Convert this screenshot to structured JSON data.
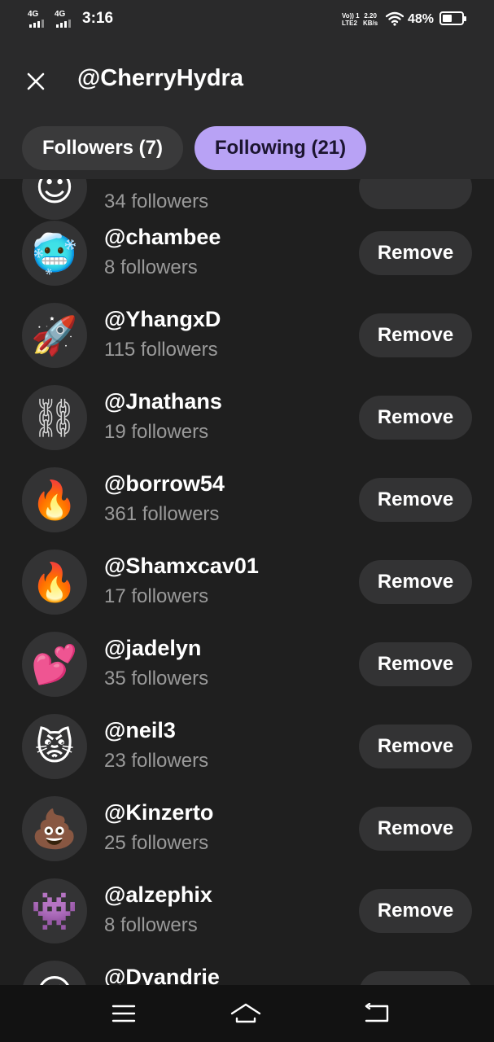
{
  "status_bar": {
    "signal1": "4G",
    "signal2": "4G",
    "time": "3:16",
    "volte_top": "Vo)) 1",
    "volte_bottom": "LTE2",
    "speed_value": "2.20",
    "speed_unit": "KB/s",
    "battery": "48%",
    "battery_level": 0.48
  },
  "header": {
    "title": "@CherryHydra",
    "tabs": [
      {
        "label": "Followers (7)",
        "selected": false
      },
      {
        "label": "Following (21)",
        "selected": true
      }
    ]
  },
  "list": {
    "items": [
      {
        "username": "",
        "followers": "34 followers",
        "avatar": "😇",
        "remove_label": ""
      },
      {
        "username": "@chambee",
        "followers": "8 followers",
        "avatar": "🥶",
        "remove_label": "Remove"
      },
      {
        "username": "@YhangxD",
        "followers": "115 followers",
        "avatar": "🚀",
        "remove_label": "Remove"
      },
      {
        "username": "@Jnathans",
        "followers": "19 followers",
        "avatar": "⛓",
        "remove_label": "Remove"
      },
      {
        "username": "@borrow54",
        "followers": "361 followers",
        "avatar": "🔥",
        "remove_label": "Remove"
      },
      {
        "username": "@Shamxcav01",
        "followers": "17 followers",
        "avatar": "🔥",
        "remove_label": "Remove"
      },
      {
        "username": "@jadelyn",
        "followers": "35 followers",
        "avatar": "💕",
        "remove_label": "Remove"
      },
      {
        "username": "@neil3",
        "followers": "23 followers",
        "avatar": "😾",
        "remove_label": "Remove"
      },
      {
        "username": "@Kinzerto",
        "followers": "25 followers",
        "avatar": "💩",
        "remove_label": "Remove"
      },
      {
        "username": "@alzephix",
        "followers": "8 followers",
        "avatar": "👾",
        "remove_label": "Remove"
      },
      {
        "username": "@Dyandrie",
        "followers": "",
        "avatar": "😶",
        "remove_label": ""
      }
    ]
  },
  "nav": {
    "menu_icon": "menu-icon",
    "home_icon": "home-icon",
    "back_icon": "back-icon"
  },
  "colors": {
    "background": "#1f1f1f",
    "header": "#2a2a2b",
    "tab_selected": "#b8a2f5",
    "tab_unselected": "#3a3a3b",
    "button": "#333334",
    "secondary_text": "#9a9a9a"
  }
}
